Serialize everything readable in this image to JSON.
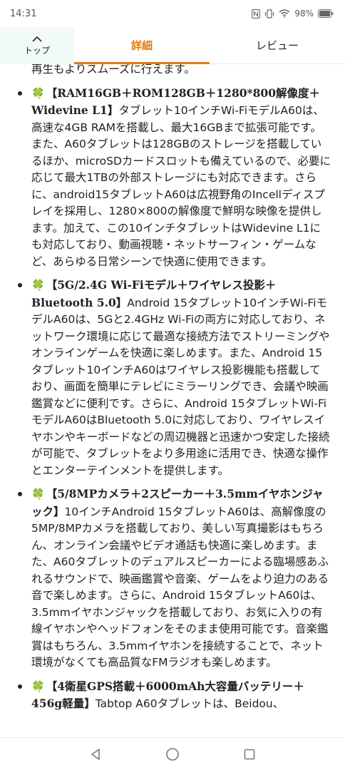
{
  "status_bar": {
    "time": "14:31",
    "battery": "98%"
  },
  "tabbar": {
    "top_label": "トップ",
    "tabs": [
      {
        "label": "詳細",
        "active": true
      },
      {
        "label": "レビュー",
        "active": false
      }
    ],
    "accent_color": "#e47911"
  },
  "content": {
    "continuation": "再生もよりスムーズに行えます。",
    "bullets": [
      {
        "heading": "【RAM16GB＋ROM128GB＋1280*800解像度＋Widevine L1】",
        "body": "タブレット10インチWi-FiモデルA60は、高速な4GB RAMを搭載し、最大16GBまで拡張可能です。また、A60タブレットは128GBのストレージを搭載しているほか、microSDカードスロットも備えているので、必要に応じて最大1TBの外部ストレージにも対応できます。さらに、android15タブレットA60は広視野角のIncellディスプレイを採用し、1280×800の解像度で鮮明な映像を提供します。加えて、この10インチタブレットはWidevine L1にも対応しており、動画視聴・ネットサーフィン・ゲームなど、あらゆる日常シーンで快適に使用できます。"
      },
      {
        "heading": "【5G/2.4G Wi-Fiモデル＋ワイヤレス投影＋Bluetooth 5.0】",
        "body": "Android 15タブレット10インチWi-FiモデルA60は、5Gと2.4GHz Wi-Fiの両方に対応しており、ネットワーク環境に応じて最適な接続方法でストリーミングやオンラインゲームを快適に楽しめます。また、Android 15タブレット10インチA60はワイヤレス投影機能も搭載しており、画面を簡単にテレビにミラーリングでき、会議や映画鑑賞などに便利です。さらに、Android 15タブレットWi-FiモデルA60はBluetooth 5.0に対応しており、ワイヤレスイヤホンやキーボードなどの周辺機器と迅速かつ安定した接続が可能で、タブレットをより多用途に活用でき、快適な操作とエンターテインメントを提供します。"
      },
      {
        "heading": "【5/8MPカメラ＋2スピーカー＋3.5mmイヤホンジャック】",
        "body": "10インチAndroid 15タブレットA60は、高解像度の5MP/8MPカメラを搭載しており、美しい写真撮影はもちろん、オンライン会議やビデオ通話も快適に楽しめます。また、A60タブレットのデュアルスピーカーによる臨場感あふれるサウンドで、映画鑑賞や音楽、ゲームをより迫力のある音で楽しめます。さらに、Android 15タブレットA60は、3.5mmイヤホンジャックを搭載しており、お気に入りの有線イヤホンやヘッドフォンをそのまま使用可能です。音楽鑑賞はもちろん、3.5mmイヤホンを接続することで、ネット環境がなくても高品質なFMラジオも楽しめます。"
      },
      {
        "heading": "【4衛星GPS搭載＋6000mAh大容量バッテリー＋456g軽量】",
        "body": "Tabtop A60タブレットは、Beidou、"
      }
    ],
    "clover_glyph": "🍀",
    "clover_color": "#3c9a3c"
  }
}
